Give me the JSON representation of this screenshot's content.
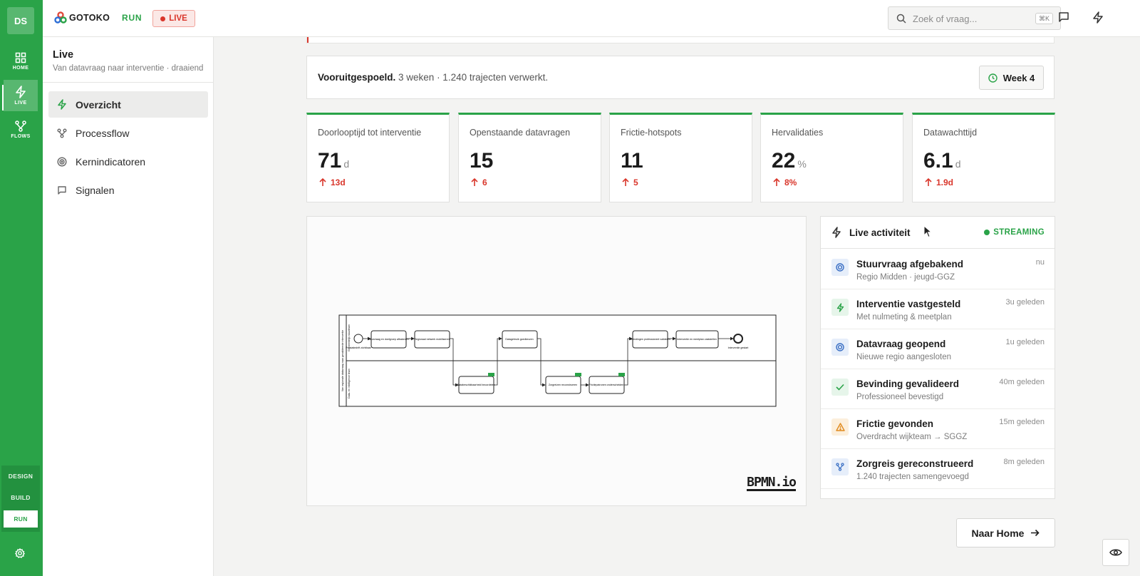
{
  "rail": {
    "avatar": "DS",
    "items": [
      {
        "label": "HOME",
        "icon": "grid-icon"
      },
      {
        "label": "LIVE",
        "icon": "bolt-icon"
      },
      {
        "label": "FLOWS",
        "icon": "flow-icon"
      }
    ],
    "modes": [
      "DESIGN",
      "BUILD",
      "RUN"
    ],
    "selected_mode": "RUN"
  },
  "header": {
    "logo_text": "GOTOKO",
    "mode_label": "RUN",
    "live_badge": "LIVE",
    "search": {
      "placeholder": "Zoek of vraag...",
      "shortcut": "⌘K"
    }
  },
  "sidebar": {
    "title": "Live",
    "subtitle": "Van datavraag naar interventie · draaiend",
    "items": [
      {
        "label": "Overzicht",
        "icon": "bolt-icon",
        "active": true
      },
      {
        "label": "Processflow",
        "icon": "flow-icon",
        "active": false
      },
      {
        "label": "Kernindicatoren",
        "icon": "target-icon",
        "active": false
      },
      {
        "label": "Signalen",
        "icon": "message-icon",
        "active": false
      }
    ]
  },
  "progress": {
    "bold": "Vooruitgespoeld.",
    "text": "3 weken · 1.240 trajecten verwerkt.",
    "week_label": "Week 4"
  },
  "kpis": [
    {
      "title": "Doorlooptijd tot interventie",
      "value": "71",
      "unit": "d",
      "delta": "13d"
    },
    {
      "title": "Openstaande datavragen",
      "value": "15",
      "unit": "",
      "delta": "6"
    },
    {
      "title": "Frictie-hotspots",
      "value": "11",
      "unit": "",
      "delta": "5"
    },
    {
      "title": "Hervalidaties",
      "value": "22",
      "unit": "%",
      "delta": "8%"
    },
    {
      "title": "Datawachttijd",
      "value": "6.1",
      "unit": "d",
      "delta": "1.9d"
    }
  ],
  "diagram": {
    "logo": "BPMN.io",
    "nodes": {
      "start": "Prestatiedrift zichtbaar",
      "t1": "Stuurvraag en doelgroep afbakenen",
      "t2": "Regionaal netwerk mobiliseren",
      "t3": "Datagebruik goedkeuren",
      "t4": "Bevindingen professioneel valideren",
      "t5": "Interventie en meetplan vaststellen",
      "end": "Interventie gestart",
      "b1": "Databeschikbaarheid beoordelen",
      "b2": "Zorgreizen reconstrueren",
      "b3": "Frictiepatronen onderscheiden"
    },
    "lanes": [
      "Gemeentelijk stuurteam",
      "Data- en intelligence team"
    ],
    "pool": "Van regionale datavraag naar gevalideerde interventie",
    "badge_color": "#2aa348"
  },
  "activity": {
    "title": "Live activiteit",
    "status": "STREAMING",
    "items": [
      {
        "title": "Stuurvraag afgebakend",
        "sub": "Regio Midden · jeugd-GGZ",
        "time": "nu",
        "icon": "target-icon",
        "color": "#3a6fc4"
      },
      {
        "title": "Interventie vastgesteld",
        "sub": "Met nulmeting & meetplan",
        "time": "3u geleden",
        "icon": "bolt-icon",
        "color": "#2aa348"
      },
      {
        "title": "Datavraag geopend",
        "sub": "Nieuwe regio aangesloten",
        "time": "1u geleden",
        "icon": "target-icon",
        "color": "#3a6fc4"
      },
      {
        "title": "Bevinding gevalideerd",
        "sub": "Professioneel bevestigd",
        "time": "40m geleden",
        "icon": "check-icon",
        "color": "#2aa348"
      },
      {
        "title": "Frictie gevonden",
        "sub": "Overdracht wijkteam → SGGZ",
        "time": "15m geleden",
        "icon": "warning-icon",
        "color": "#e08a1e"
      },
      {
        "title": "Zorgreis gereconstrueerd",
        "sub": "1.240 trajecten samengevoegd",
        "time": "8m geleden",
        "icon": "flow-icon",
        "color": "#3a6fc4"
      }
    ]
  },
  "footer": {
    "home_button": "Naar Home"
  }
}
